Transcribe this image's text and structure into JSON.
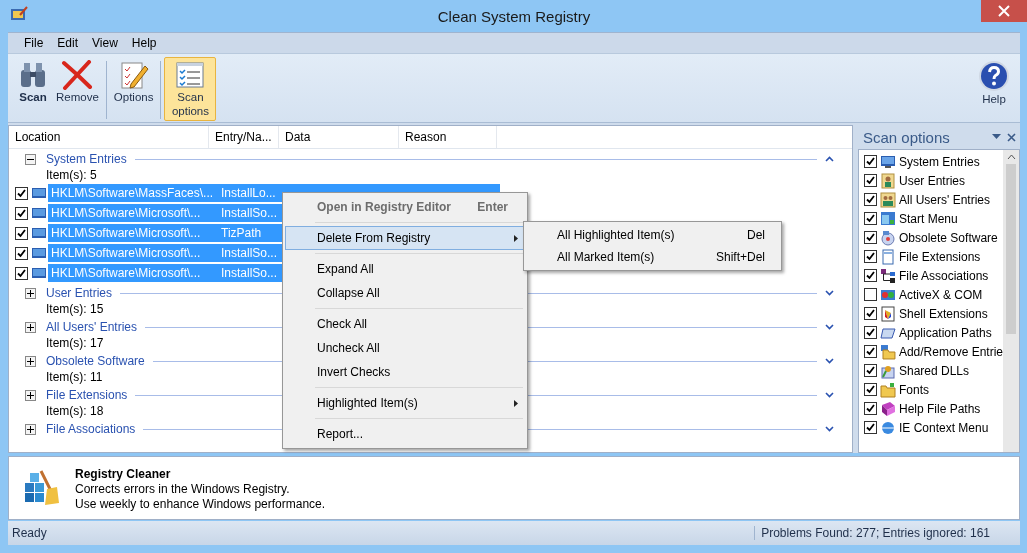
{
  "window": {
    "title": "Clean System Registry"
  },
  "menu_bar": [
    "File",
    "Edit",
    "View",
    "Help"
  ],
  "toolbar": [
    {
      "label": "Scan",
      "kind": "binoculars",
      "selected": false,
      "bold": true
    },
    {
      "label": "Remove",
      "kind": "cross",
      "selected": false,
      "bold": false
    },
    {
      "label": "Options",
      "kind": "notepad",
      "selected": false,
      "bold": false
    },
    {
      "label": "Scan options",
      "kind": "checklist",
      "selected": true,
      "bold": false
    },
    {
      "label": "Help",
      "kind": "help",
      "selected": false,
      "bold": false
    }
  ],
  "table": {
    "columns": [
      "Location",
      "Entry/Na...",
      "Data",
      "Reason"
    ],
    "groups": [
      {
        "title": "System Entries",
        "count": "Item(s): 5",
        "expanded": true,
        "rows": [
          {
            "location": "HKLM\\Software\\MassFaces\\...",
            "entry": "InstallLo...",
            "checked": true,
            "selected": true
          },
          {
            "location": "HKLM\\Software\\Microsoft\\...",
            "entry": "InstallSo...",
            "checked": true,
            "selected": true
          },
          {
            "location": "HKLM\\Software\\Microsoft\\...",
            "entry": "TizPath",
            "checked": true,
            "selected": true
          },
          {
            "location": "HKLM\\Software\\Microsoft\\...",
            "entry": "InstallSo...",
            "checked": true,
            "selected": true
          },
          {
            "location": "HKLM\\Software\\Microsoft\\...",
            "entry": "InstallSo...",
            "checked": true,
            "selected": true
          }
        ]
      },
      {
        "title": "User Entries",
        "count": "Item(s): 15",
        "expanded": false
      },
      {
        "title": "All Users' Entries",
        "count": "Item(s): 17",
        "expanded": false
      },
      {
        "title": "Obsolete Software",
        "count": "Item(s): 11",
        "expanded": false
      },
      {
        "title": "File Extensions",
        "count": "Item(s): 18",
        "expanded": false
      },
      {
        "title": "File Associations",
        "expanded": false
      }
    ]
  },
  "context_menu": {
    "items": [
      {
        "kind": "item",
        "label": "Open in Registry Editor",
        "shortcut": "Enter",
        "bold": true,
        "disabled": true,
        "selected": false,
        "submenu": false
      },
      {
        "kind": "separator"
      },
      {
        "kind": "item",
        "label": "Delete From Registry",
        "bold": false,
        "disabled": false,
        "selected": true,
        "submenu": true
      },
      {
        "kind": "separator"
      },
      {
        "kind": "item",
        "label": "Expand All",
        "bold": false,
        "disabled": false,
        "selected": false,
        "submenu": false
      },
      {
        "kind": "item",
        "label": "Collapse All",
        "bold": false,
        "disabled": false,
        "selected": false,
        "submenu": false
      },
      {
        "kind": "separator"
      },
      {
        "kind": "item",
        "label": "Check All",
        "bold": false,
        "disabled": false,
        "selected": false,
        "submenu": false
      },
      {
        "kind": "item",
        "label": "Uncheck All",
        "bold": false,
        "disabled": false,
        "selected": false,
        "submenu": false
      },
      {
        "kind": "item",
        "label": "Invert Checks",
        "bold": false,
        "disabled": false,
        "selected": false,
        "submenu": false
      },
      {
        "kind": "separator"
      },
      {
        "kind": "item",
        "label": "Highlighted Item(s)",
        "bold": false,
        "disabled": false,
        "selected": false,
        "submenu": true
      },
      {
        "kind": "separator"
      },
      {
        "kind": "item",
        "label": "Report...",
        "bold": false,
        "disabled": false,
        "selected": false,
        "submenu": false
      }
    ],
    "submenu": [
      {
        "label": "All Highlighted Item(s)",
        "shortcut": "Del"
      },
      {
        "label": "All Marked Item(s)",
        "shortcut": "Shift+Del"
      }
    ]
  },
  "scan_options": {
    "title": "Scan options",
    "items": [
      {
        "label": "System Entries",
        "checked": true
      },
      {
        "label": "User Entries",
        "checked": true
      },
      {
        "label": "All Users' Entries",
        "checked": true
      },
      {
        "label": "Start Menu",
        "checked": true
      },
      {
        "label": "Obsolete Software",
        "checked": true
      },
      {
        "label": "File Extensions",
        "checked": true
      },
      {
        "label": "File Associations",
        "checked": true
      },
      {
        "label": "ActiveX & COM",
        "checked": false
      },
      {
        "label": "Shell Extensions",
        "checked": true
      },
      {
        "label": "Application Paths",
        "checked": true
      },
      {
        "label": "Add/Remove Entrie",
        "checked": true
      },
      {
        "label": "Shared DLLs",
        "checked": true
      },
      {
        "label": "Fonts",
        "checked": true
      },
      {
        "label": "Help File Paths",
        "checked": true
      },
      {
        "label": "IE Context Menu",
        "checked": true
      }
    ]
  },
  "info": {
    "title": "Registry Cleaner",
    "lines": [
      "Corrects errors in the Windows Registry.",
      "Use weekly to enhance Windows performance."
    ]
  },
  "status_bar": {
    "left": "Ready",
    "right": "Problems Found: 277;  Entries ignored: 161"
  }
}
